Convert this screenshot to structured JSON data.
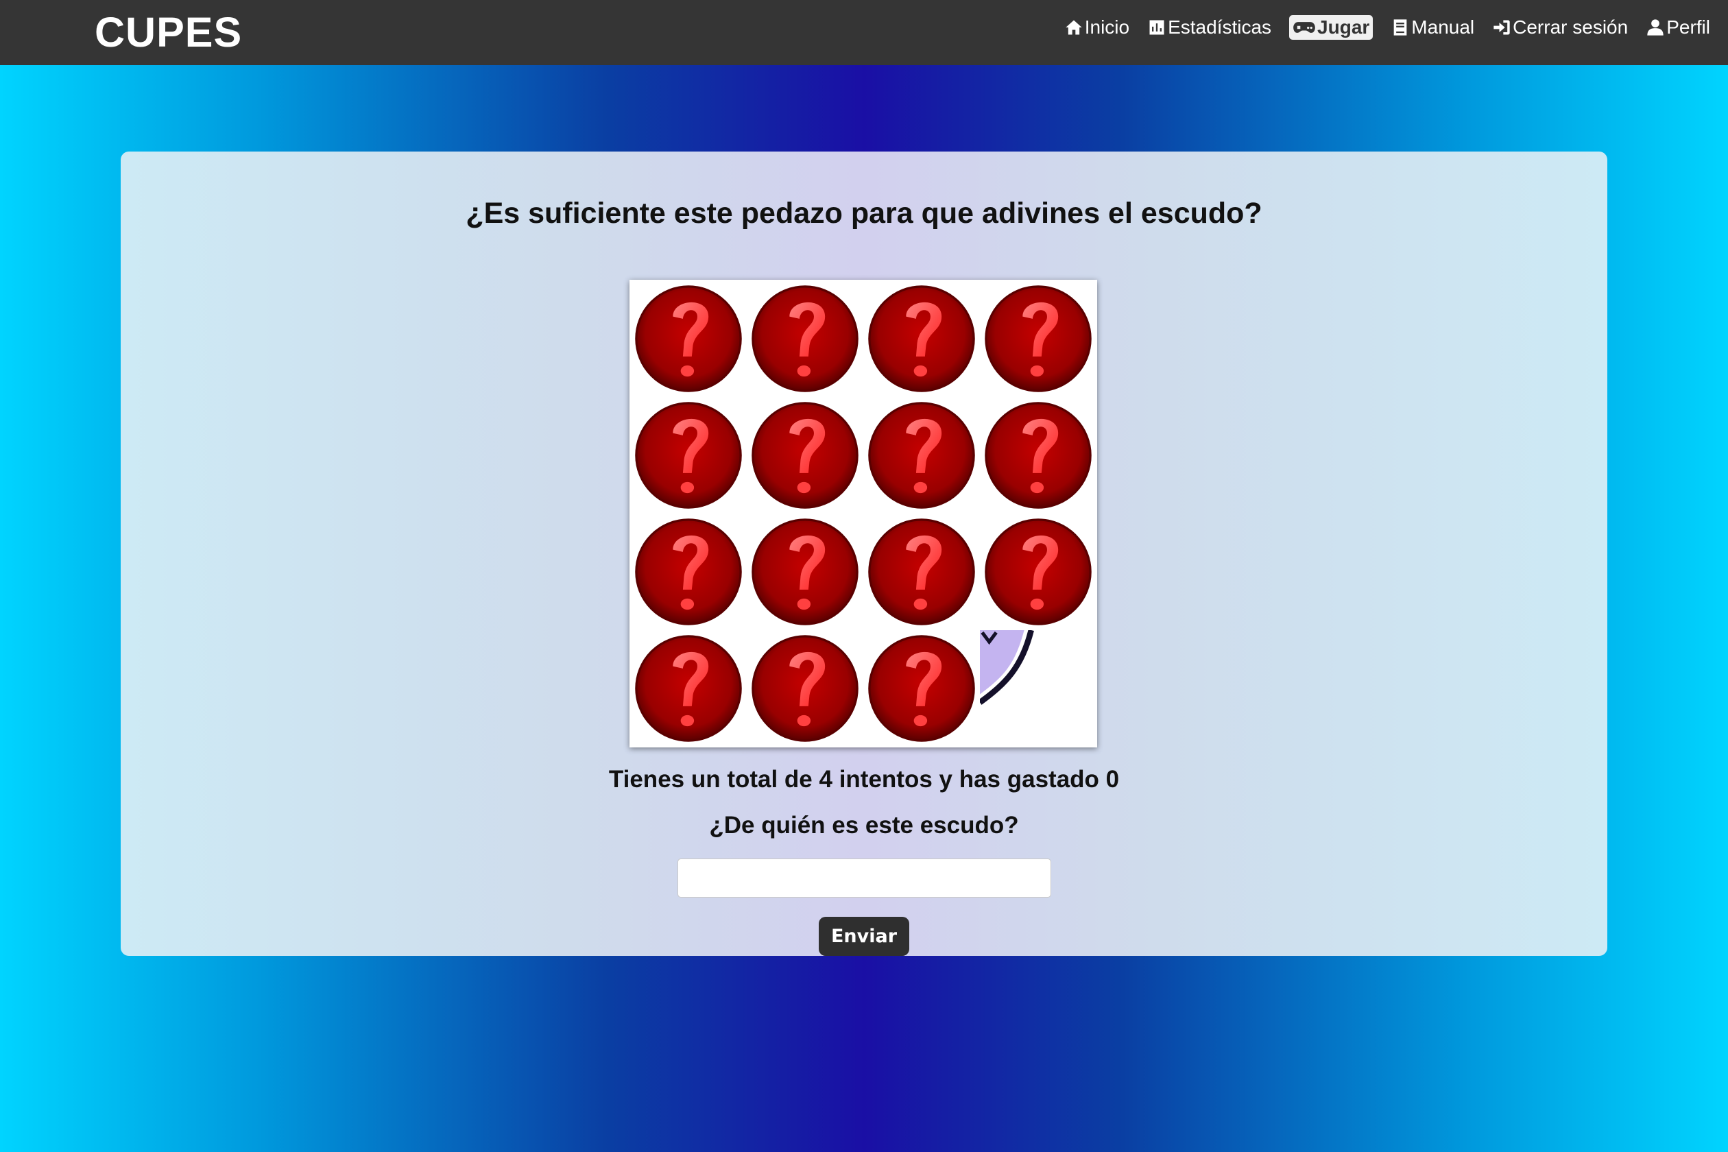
{
  "navbar": {
    "brand": "CUPES",
    "items": [
      {
        "label": "Inicio",
        "icon": "home-icon",
        "active": false
      },
      {
        "label": "Estadísticas",
        "icon": "chart-icon",
        "active": false
      },
      {
        "label": "Jugar",
        "icon": "gamepad-icon",
        "active": true
      },
      {
        "label": "Manual",
        "icon": "book-icon",
        "active": false
      },
      {
        "label": "Cerrar sesión",
        "icon": "logout-icon",
        "active": false
      },
      {
        "label": "Perfil",
        "icon": "user-icon",
        "active": false
      }
    ]
  },
  "game": {
    "title": "¿Es suficiente este pedazo para que adivines el escudo?",
    "grid": {
      "rows": 4,
      "cols": 4,
      "hidden_tile_icon": "red-question-mark-icon",
      "revealed_tile_index": 15
    },
    "attempts_text": "Tienes un total de 4 intentos y has gastado 0",
    "question": "¿De quién es este escudo?",
    "answer": {
      "value": "",
      "placeholder": ""
    },
    "submit_label": "Enviar"
  },
  "colors": {
    "navbar_bg": "#353535",
    "tile_red": "#b80000",
    "revealed_purple": "#c4b4f0",
    "button_bg": "#2f2f2f"
  }
}
